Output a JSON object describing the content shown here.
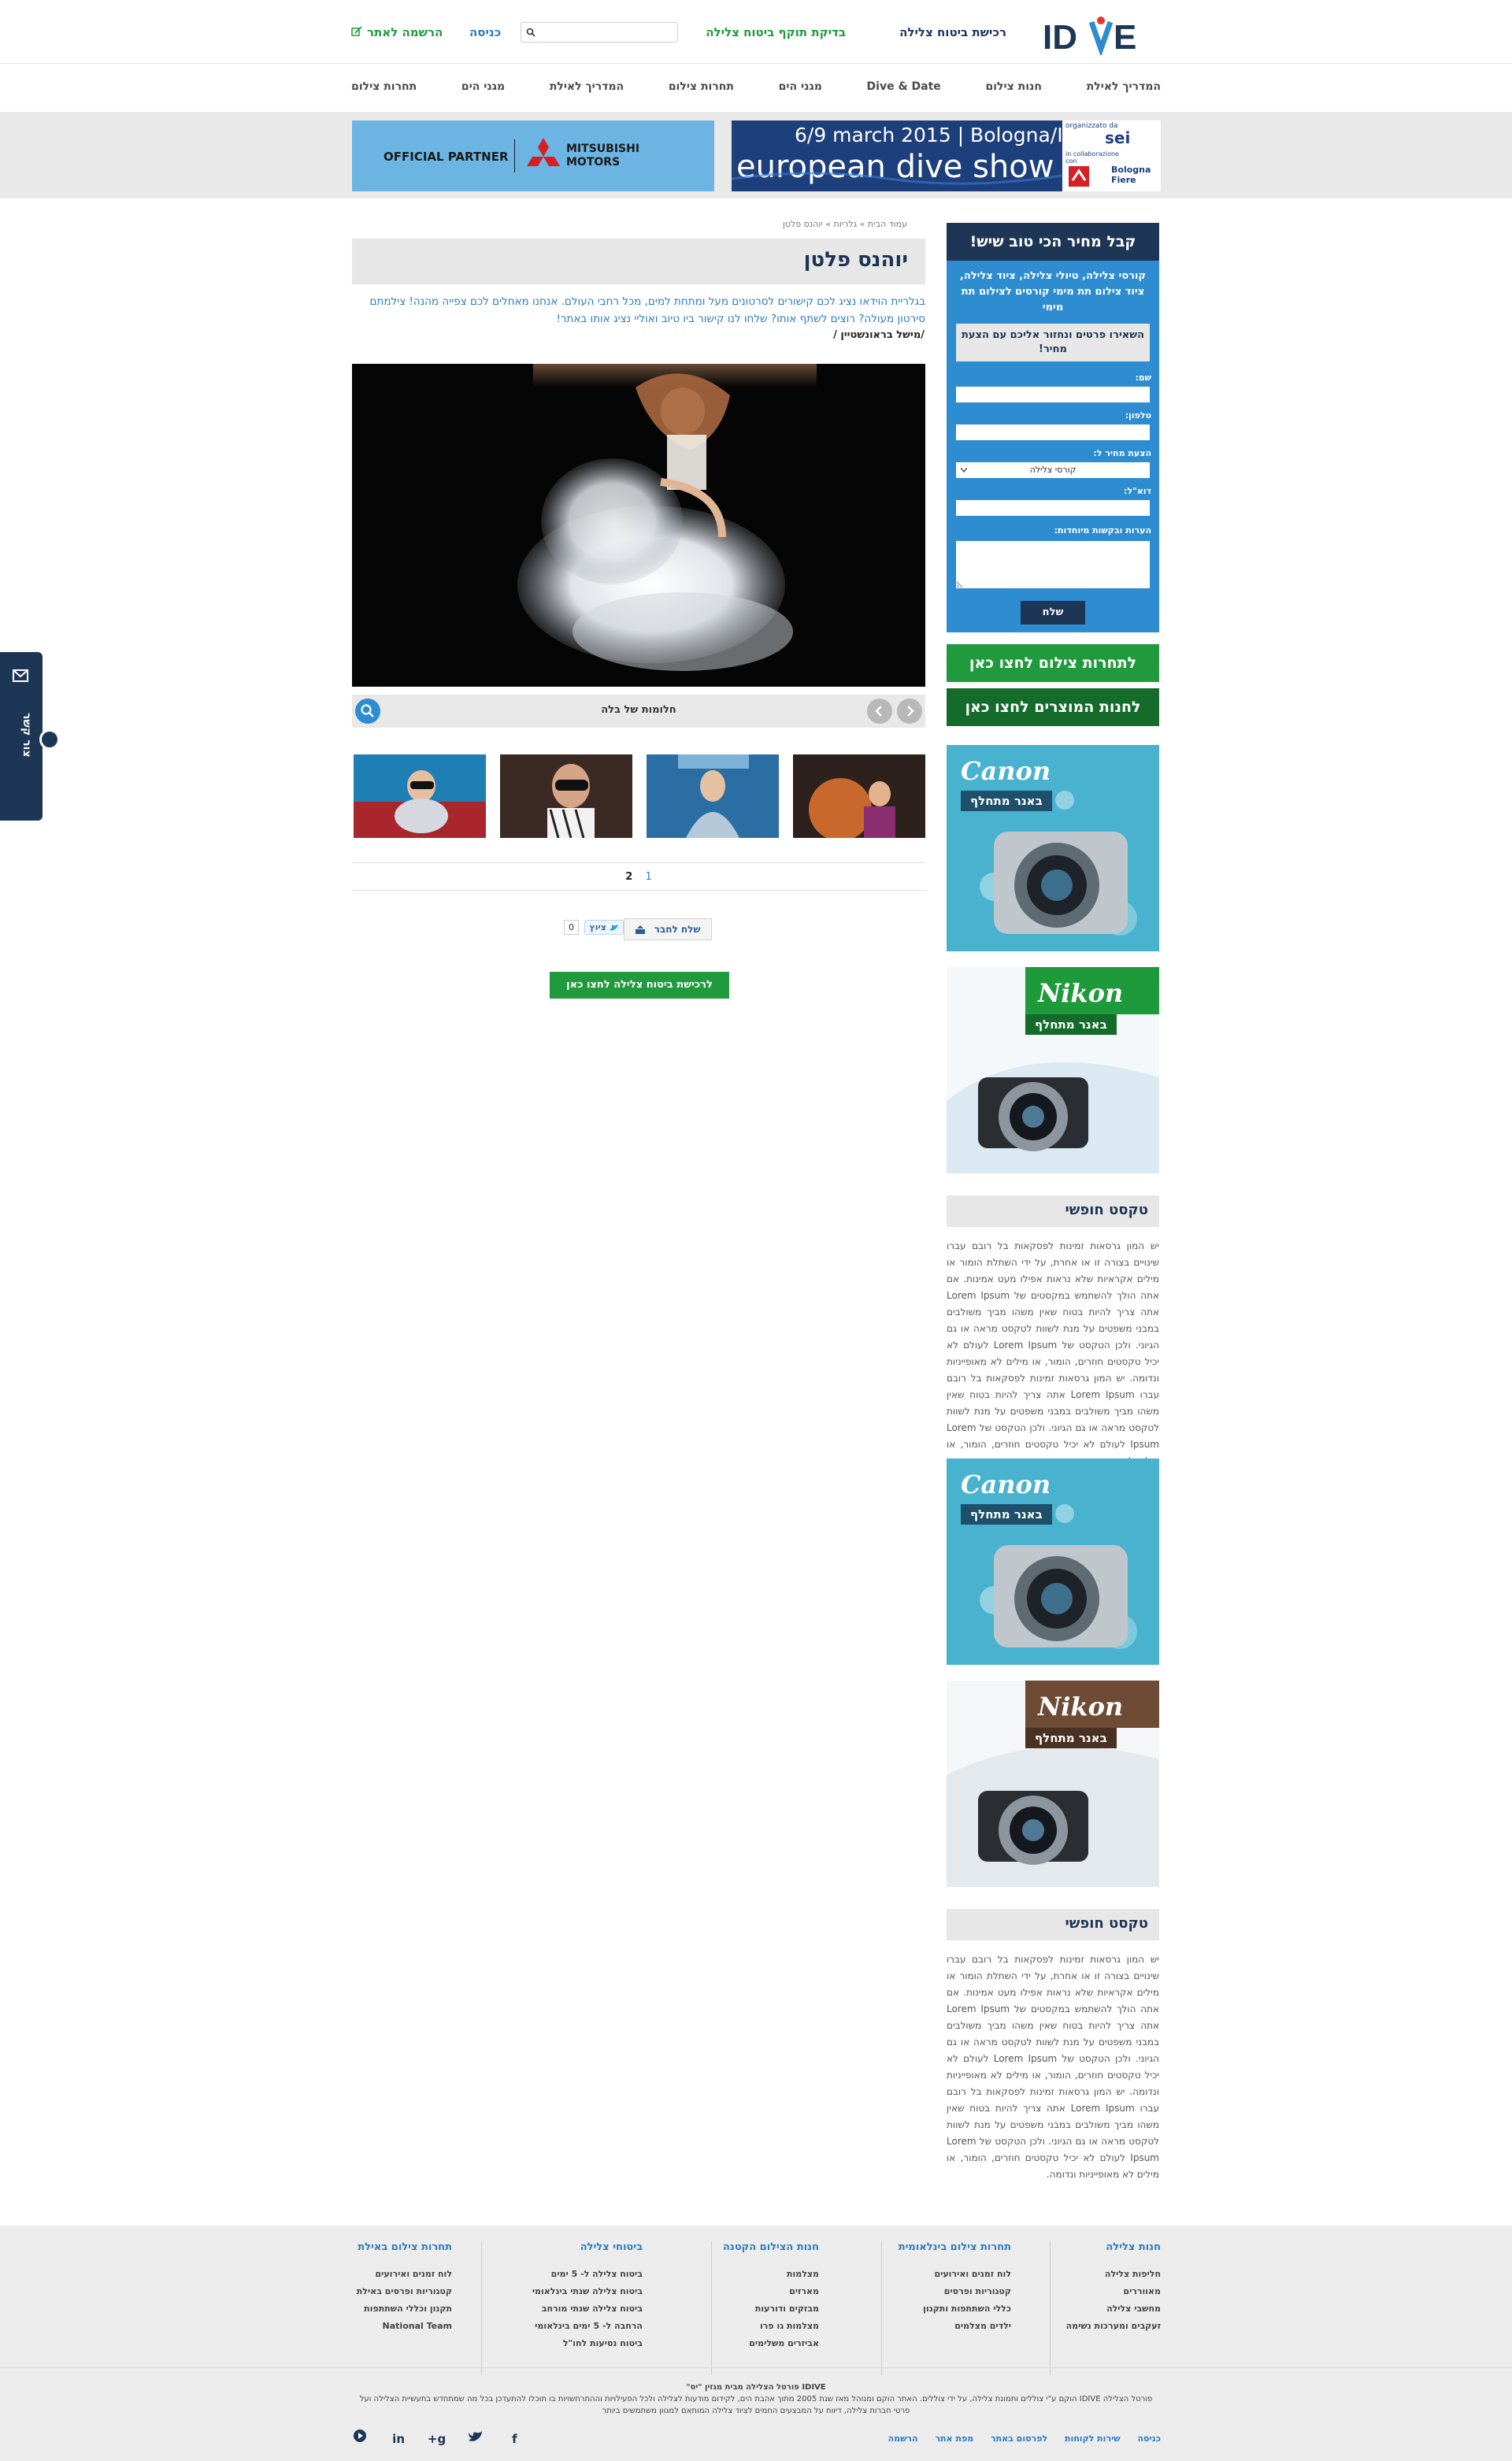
{
  "header": {
    "logo_text": "IDIVE",
    "link_insurance_buy": "רכישת ביטוח צלילה",
    "link_insurance_check": "בדיקת תוקף ביטוח צלילה",
    "link_login": "כניסה",
    "link_register": "הרשמה לאתר",
    "search_placeholder": ""
  },
  "nav": {
    "items": [
      "המדריך לאילת",
      "חנות צילום",
      "Dive & Date",
      "מגני הים",
      "תחרות צילום",
      "המדריך לאילת",
      "מגני הים",
      "תחרות צילום"
    ]
  },
  "ads": {
    "left_text": "OFFICIAL PARTNER",
    "left_brand": "MITSUBISHI MOTORS",
    "right_date": "6/9 march 2015 | Bologna/Italy",
    "right_title": "european dive show",
    "right_small": "organizzato da",
    "right_sei": "sei",
    "right_collab": "in collaborazione con",
    "right_fiere": "Bologna Fiere"
  },
  "main": {
    "breadcrumb": "עמוד הבית » גלריות » יוהנס פלטן",
    "title": "יוהנס פלטן",
    "intro": "בגלריית הוידאו נציג לכם קישורים לסרטונים מעל ומתחת למים, מכל רחבי העולם. אנחנו מאחלים לכם צפייה מהנה! צילמתם סירטון מעולה? רוצים לשתף אותו? שלחו לנו קישור ביו טיוב ואוליי נציג אותו באתר!",
    "author": "/מישל בראונשטיין /",
    "caption": "חלומות של בלה",
    "pages": [
      "1",
      "2"
    ],
    "send_friend": "שלח לחבר",
    "tweet": "ציוץ",
    "tweet_count": "0",
    "cta": "לרכישת ביטוח צלילה לחצו כאן"
  },
  "sidebar": {
    "form_title": "קבל מחיר הכי טוב שיש!",
    "form_intro": "קורסי צלילה, טיולי צלילה, ציוד צלילה, ציוד צילום תת מימי קורסים לצילום תת מימי",
    "form_button": "השאירו פרטים ונחזור אליכם עם הצעת מחיר!",
    "label_name": "שם:",
    "label_phone": "טלפון:",
    "label_offer": "הצעת מחיר ל:",
    "select_value": "קורסי צלילה",
    "label_email": "דוא\"ל:",
    "label_notes": "הערות ובקשות מיוחדות:",
    "submit": "שלח",
    "green_contest": "לתחרות צילום לחצו כאן",
    "green_shop": "לחנות המוצרים לחצו כאן",
    "ad_canon": "Canon",
    "ad_nikon": "Nikon",
    "ad_alt": "באנר מתחלף",
    "free_title": "טקסט חופשי",
    "free_text": "יש המון גרסאות זמינות לפסקאות בל רובם עברו שינויים בצורה זו או אחרת, על ידי השתלת הומור או מילים אקראיות שלא נראות אפילו מעט אמינות. אם אתה הולך להשתמש במקסטים של Lorem Ipsum אתה צריך להיות בטוח שאין משהו מביך משולבים במבני משפטים על מנת לשוות לטקסט מראה או גם הגיוני. ולכן הטקסט של Lorem Ipsum לעולם לא יכיל טקסטים חוזרים, הומור, או מילים לא מאופייניות ונדומה. יש המון גרסאות זמינות לפסקאות בל רובם עברו Lorem Ipsum אתה צריך להיות בטוח שאין משהו מביך משולבים במבני משפטים על מנת לשוות לטקסט מראה או גם הגיוני. ולכן הטקסט של Lorem Ipsum לעולם לא יכיל טקסטים חוזרים, הומור, או מילים לא מאופייניות ונדומה."
  },
  "side_tab": {
    "label": "צור קשר"
  },
  "footer": {
    "cols": [
      {
        "title": "חנות צלילה",
        "items": [
          "חליפות צלילה",
          "מאווררים",
          "מחשבי צלילה",
          "זעקבים ומערכות נשימה"
        ]
      },
      {
        "title": "תחרות צילום בינלאומית",
        "items": [
          "לוח זמנים ואירועים",
          "קטגוריות ופרסים",
          "כללי השתתפות ותקנון",
          "ילדים מצלמים"
        ]
      },
      {
        "title": "חנות הצילום הקטנה",
        "items": [
          "מצלמות",
          "מארזים",
          "מבזקים ודורעות",
          "מצלמות גו פרו",
          "אביזרים משלימים"
        ]
      },
      {
        "title": "ביטוחי צלילה",
        "items": [
          "ביטוח צלילה ל- 5 ימים",
          "ביטוח צלילה שנתי בינלאומי",
          "ביטוח צלילה שנתי מורחב",
          "הרחבה ל- 5 ימים בינלאומי",
          "ביטוח נסיעות לחו\"ל"
        ]
      },
      {
        "title": "תחרות צילום באילת",
        "items": [
          "לוח זמנים ואירועים",
          "קטגוריות ופרסים באילת",
          "תקנון וכללי השתתפות",
          "National Team"
        ]
      }
    ],
    "copyright_1": "IDIVE פורטל הצלילה מבית מגזין \"יס\"",
    "copyright_2": "פורטל הצלילה IDIVE הוקם ע\"י צוללים ותמונת צלילה, על ידי צוללים. האתר הוקם ומנוהל מאז שנת 2005 מתוך אהבת הים, לקידום מודעות לצלילה ולכל הפעילויות וההתרחשויות בו תוכלו להתעדכן בכל מה שמתחדש בתעשיית הצלילה ועל פרטי חברות צלילה, דיווח על המבצעים החמים לציוד צלילה המותאם למגוון משתמשים ביותר",
    "links": [
      "כניסה",
      "שירות לקוחות",
      "לפרסום באתר",
      "מפת אתר",
      "הרשמה"
    ]
  },
  "colors": {
    "navy": "#1e3656",
    "blue": "#2e8cd0",
    "green": "#219a3d",
    "dark_green": "#146b2a",
    "light_gray": "#e7e7e7"
  }
}
